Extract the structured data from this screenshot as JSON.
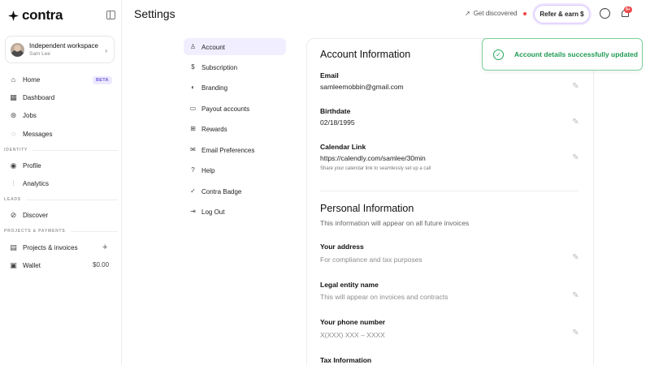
{
  "brand": {
    "name": "contra"
  },
  "workspace": {
    "title": "Independent workspace",
    "user": "Sam Lee"
  },
  "nav": {
    "home": "Home",
    "home_badge": "BETA",
    "dashboard": "Dashboard",
    "jobs": "Jobs",
    "messages": "Messages",
    "identity_label": "IDENTITY",
    "profile": "Profile",
    "analytics": "Analytics",
    "leads_label": "LEADS",
    "discover": "Discover",
    "projects_label": "PROJECTS & PAYMENTS",
    "projects": "Projects & invoices",
    "wallet": "Wallet",
    "wallet_value": "$0.00"
  },
  "header": {
    "title": "Settings",
    "get_discovered": "Get discovered",
    "refer": "Refer & earn $",
    "notification_badge": "9+"
  },
  "settings_nav": [
    {
      "label": "Account",
      "icon": "user-icon",
      "active": true
    },
    {
      "label": "Subscription",
      "icon": "dollar-icon"
    },
    {
      "label": "Branding",
      "icon": "branding-icon"
    },
    {
      "label": "Payout accounts",
      "icon": "payout-icon"
    },
    {
      "label": "Rewards",
      "icon": "gift-icon"
    },
    {
      "label": "Email Preferences",
      "icon": "mail-icon"
    },
    {
      "label": "Help",
      "icon": "help-icon"
    },
    {
      "label": "Contra Badge",
      "icon": "badge-icon"
    },
    {
      "label": "Log Out",
      "icon": "logout-icon"
    }
  ],
  "account": {
    "heading": "Account Information",
    "email_label": "Email",
    "email_value": "samleemobbin@gmail.com",
    "birthdate_label": "Birthdate",
    "birthdate_value": "02/18/1995",
    "calendar_label": "Calendar Link",
    "calendar_value": "https://calendly.com/samlee/30min",
    "calendar_help": "Share your calendar link to seamlessly set up a call"
  },
  "personal": {
    "heading": "Personal Information",
    "subheading": "This information will appear on all future invoices",
    "address_label": "Your address",
    "address_placeholder": "For compliance and tax purposes",
    "entity_label": "Legal entity name",
    "entity_placeholder": "This will appear on invoices and contracts",
    "phone_label": "Your phone number",
    "phone_placeholder": "X(XXX) XXX – XXXX",
    "tax_label": "Tax Information"
  },
  "toast": {
    "message": "Account details successfully updated"
  },
  "colors": {
    "accent": "#6b5bd6",
    "active_bg": "#f1efff",
    "success": "#22a85a",
    "alert": "#f04747"
  }
}
